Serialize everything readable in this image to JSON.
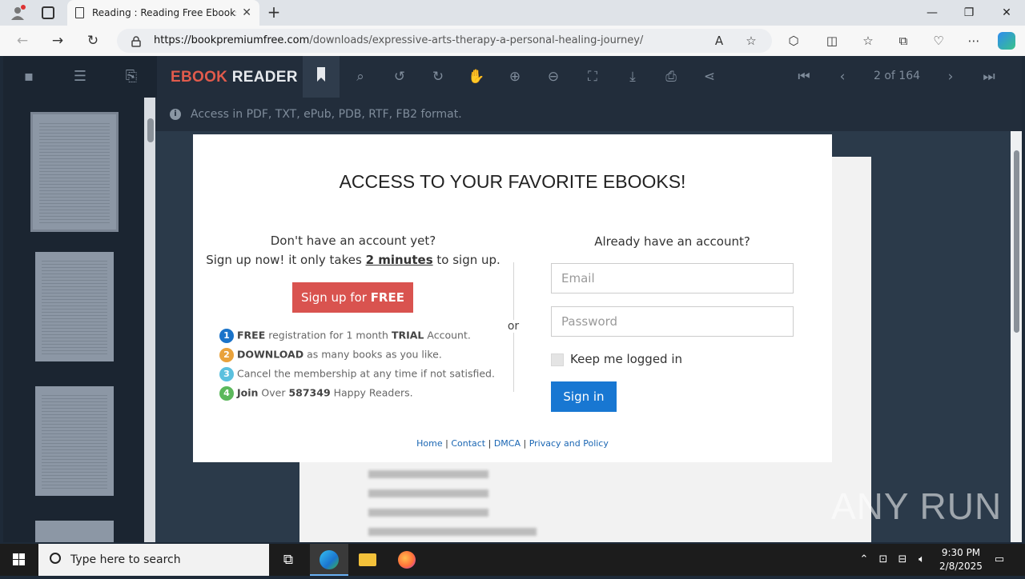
{
  "browser": {
    "tab_title": "Reading : Reading Free Ebooks | ",
    "url_host": "https://bookpremiumfree.com",
    "url_path": "/downloads/expressive-arts-therapy-a-personal-healing-journey/"
  },
  "reader": {
    "brand_first": "EBOOK",
    "brand_second": " READER",
    "page_indicator": "2 of 164",
    "notice": "Access in PDF, TXT, ePub, PDB, RTF, FB2 format."
  },
  "modal": {
    "title": "ACCESS TO YOUR FAVORITE EBOOKS!",
    "no_account": "Don't have an account yet?",
    "signup_prefix": "Sign up now! it only takes ",
    "signup_bold": "2 minutes",
    "signup_suffix": " to sign up.",
    "signup_button_prefix": "Sign up for ",
    "signup_button_bold": "FREE",
    "features": [
      {
        "num": "1",
        "color": "#1a73c9",
        "bold": "FREE",
        "text": " registration for 1 month ",
        "bold2": "TRIAL",
        "text2": " Account."
      },
      {
        "num": "2",
        "color": "#e9a23b",
        "bold": "DOWNLOAD",
        "text": " as many books as you like.",
        "bold2": "",
        "text2": ""
      },
      {
        "num": "3",
        "color": "#5bc0de",
        "bold": "",
        "text": "Cancel the membership at any time if not satisfied.",
        "bold2": "",
        "text2": ""
      },
      {
        "num": "4",
        "color": "#5cb85c",
        "bold": "Join",
        "text": " Over ",
        "bold2": "587349",
        "text2": " Happy Readers."
      }
    ],
    "or": "or",
    "have_account": "Already have an account?",
    "email_placeholder": "Email",
    "password_placeholder": "Password",
    "keep_logged": "Keep me logged in",
    "signin_button": "Sign in",
    "footer_links": [
      "Home",
      "Contact",
      "DMCA",
      "Privacy and Policy"
    ]
  },
  "taskbar": {
    "search_placeholder": "Type here to search",
    "time": "9:30 PM",
    "date": "2/8/2025"
  },
  "watermark": "ANY RUN",
  "colors": {
    "brand_red": "#e25b4c",
    "signup_red": "#d9534f",
    "signin_blue": "#1877d2"
  }
}
